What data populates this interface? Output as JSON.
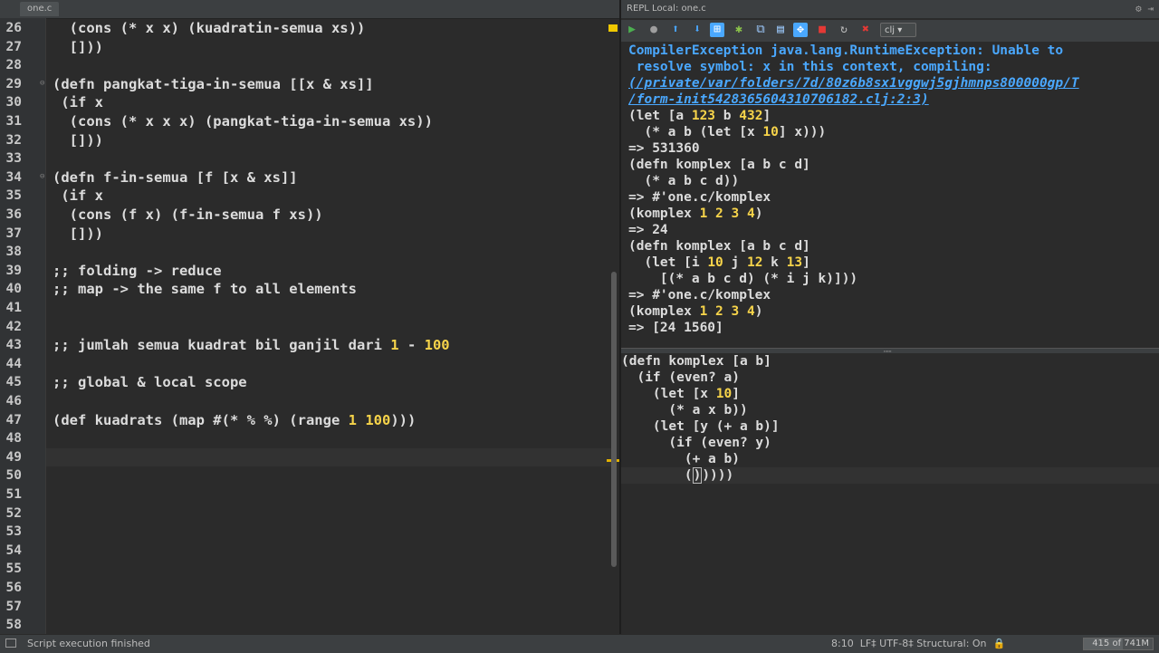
{
  "editor": {
    "tab_label": "one.c",
    "lines": [
      {
        "n": "26",
        "html": "  (cons (* x x) (kuadratin-semua xs))"
      },
      {
        "n": "27",
        "html": "  []))"
      },
      {
        "n": "28",
        "html": ""
      },
      {
        "n": "29",
        "html": "(defn pangkat-tiga-in-semua [[x & xs]]"
      },
      {
        "n": "30",
        "html": " (if x"
      },
      {
        "n": "31",
        "html": "  (cons (* x x x) (pangkat-tiga-in-semua xs))"
      },
      {
        "n": "32",
        "html": "  []))"
      },
      {
        "n": "33",
        "html": ""
      },
      {
        "n": "34",
        "html": "(defn f-in-semua [f [x & xs]]"
      },
      {
        "n": "35",
        "html": " (if x"
      },
      {
        "n": "36",
        "html": "  (cons (f x) (f-in-semua f xs))"
      },
      {
        "n": "37",
        "html": "  []))"
      },
      {
        "n": "38",
        "html": ""
      },
      {
        "n": "39",
        "html": ";; folding -> reduce"
      },
      {
        "n": "40",
        "html": ";; map -> the same f to all elements"
      },
      {
        "n": "41",
        "html": ""
      },
      {
        "n": "42",
        "html": ""
      },
      {
        "n": "43",
        "html": ";; jumlah semua kuadrat bil ganjil dari 1 - 100"
      },
      {
        "n": "44",
        "html": ""
      },
      {
        "n": "45",
        "html": ";; global & local scope"
      },
      {
        "n": "46",
        "html": ""
      },
      {
        "n": "47",
        "html": "(def kuadrats (map #(* % %) (range 1 100)))"
      },
      {
        "n": "48",
        "html": ""
      },
      {
        "n": "49",
        "html": ""
      },
      {
        "n": "50",
        "html": ""
      },
      {
        "n": "51",
        "html": ""
      },
      {
        "n": "52",
        "html": ""
      },
      {
        "n": "53",
        "html": ""
      },
      {
        "n": "54",
        "html": ""
      },
      {
        "n": "55",
        "html": ""
      },
      {
        "n": "56",
        "html": ""
      },
      {
        "n": "57",
        "html": ""
      },
      {
        "n": "58",
        "html": ""
      }
    ]
  },
  "repl": {
    "title": "REPL Local: one.c",
    "header_controls": "⚙ ⇥",
    "language": "clj",
    "output": {
      "error_line1": "CompilerException java.lang.RuntimeException: Unable to",
      "error_line2": " resolve symbol: x in this context, compiling:",
      "error_link1": "(/private/var/folders/7d/80z6b8sx1vggwj5gjhmnps800000gp/T",
      "error_link2": "/form-init5428365604310706182.clj:2:3)",
      "l1": "(let [a 123 b 432]",
      "l2": "  (* a b (let [x 10] x)))",
      "r1": "=> 531360",
      "l3": "(defn komplex [a b c d]",
      "l4": "  (* a b c d))",
      "r2": "=> #'one.c/komplex",
      "l5": "(komplex 1 2 3 4)",
      "r3": "=> 24",
      "l6": "(defn komplex [a b c d]",
      "l7": "  (let [i 10 j 12 k 13]",
      "l8": "    [(* a b c d) (* i j k)]))",
      "r4": "=> #'one.c/komplex",
      "l9": "(komplex 1 2 3 4)",
      "r5": "=> [24 1560]"
    },
    "input": {
      "i1": "(defn komplex [a b]",
      "i2": "  (if (even? a)",
      "i3": "    (let [x 10]",
      "i4": "      (* a x b))",
      "i5": "    (let [y (+ a b)]",
      "i6": "      (if (even? y)",
      "i7": "        (+ a b)",
      "i8a": "        (",
      "i8b": ")",
      "i8c": "))))"
    }
  },
  "status": {
    "message": "Script execution finished",
    "position": "8:10",
    "line_sep": "LF‡",
    "encoding": "UTF-8‡",
    "structural": "Structural: On",
    "memory": "415 of 741M",
    "memory_used_fraction": 0.56
  },
  "colors": {
    "number": "#f7d44a",
    "error": "#4aa8ff",
    "background": "#2b2b2b"
  }
}
